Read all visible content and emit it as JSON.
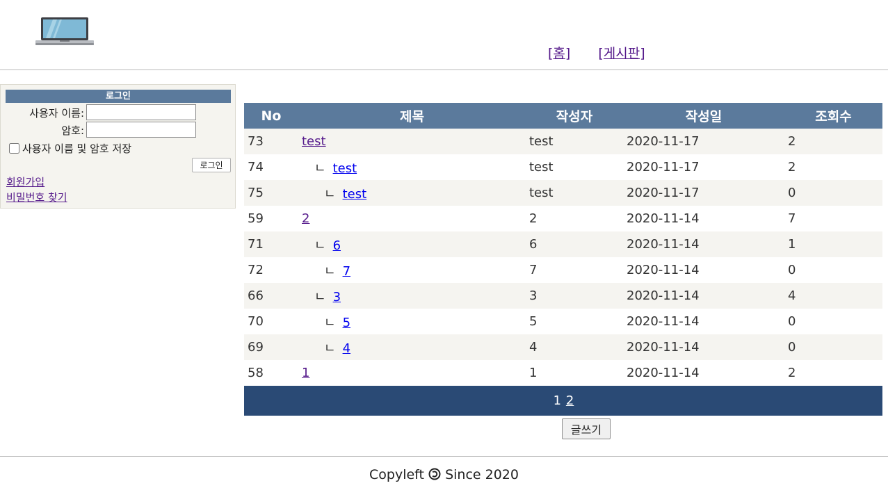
{
  "header": {
    "nav": [
      {
        "label": "[홈]"
      },
      {
        "label": "[게시판]"
      }
    ]
  },
  "login": {
    "title": "로그인",
    "username_label": "사용자 이름:",
    "password_label": "암호:",
    "username_value": "",
    "password_value": "",
    "remember_label": "사용자 이름 및 암호 저장",
    "login_button": "로그인",
    "signup_link": "회원가입",
    "find_password_link": "비밀번호 찾기"
  },
  "board": {
    "columns": [
      "No",
      "제목",
      "작성자",
      "작성일",
      "조회수"
    ],
    "rows": [
      {
        "no": "73",
        "title": "test",
        "depth": 0,
        "writer": "test",
        "date": "2020-11-17",
        "hits": "2"
      },
      {
        "no": "74",
        "title": "test",
        "depth": 1,
        "writer": "test",
        "date": "2020-11-17",
        "hits": "2"
      },
      {
        "no": "75",
        "title": "test",
        "depth": 2,
        "writer": "test",
        "date": "2020-11-17",
        "hits": "0"
      },
      {
        "no": "59",
        "title": "2",
        "depth": 0,
        "writer": "2",
        "date": "2020-11-14",
        "hits": "7"
      },
      {
        "no": "71",
        "title": "6",
        "depth": 1,
        "writer": "6",
        "date": "2020-11-14",
        "hits": "1"
      },
      {
        "no": "72",
        "title": "7",
        "depth": 2,
        "writer": "7",
        "date": "2020-11-14",
        "hits": "0"
      },
      {
        "no": "66",
        "title": "3",
        "depth": 1,
        "writer": "3",
        "date": "2020-11-14",
        "hits": "4"
      },
      {
        "no": "70",
        "title": "5",
        "depth": 2,
        "writer": "5",
        "date": "2020-11-14",
        "hits": "0"
      },
      {
        "no": "69",
        "title": "4",
        "depth": 2,
        "writer": "4",
        "date": "2020-11-14",
        "hits": "0"
      },
      {
        "no": "58",
        "title": "1",
        "depth": 0,
        "writer": "1",
        "date": "2020-11-14",
        "hits": "2"
      }
    ],
    "reply_marker": "ㄴ",
    "pagination": {
      "current": "1",
      "other": "2"
    },
    "write_button": "글쓰기"
  },
  "footer": {
    "prefix": "Copyleft",
    "suffix": "Since 2020"
  },
  "colors": {
    "header_bg": "#5b7a9c",
    "pager_bg": "#2a4a75",
    "row_alt": "#f5f4f0"
  },
  "icons": {
    "logo": "laptop-icon",
    "copyleft": "copyleft-icon"
  }
}
